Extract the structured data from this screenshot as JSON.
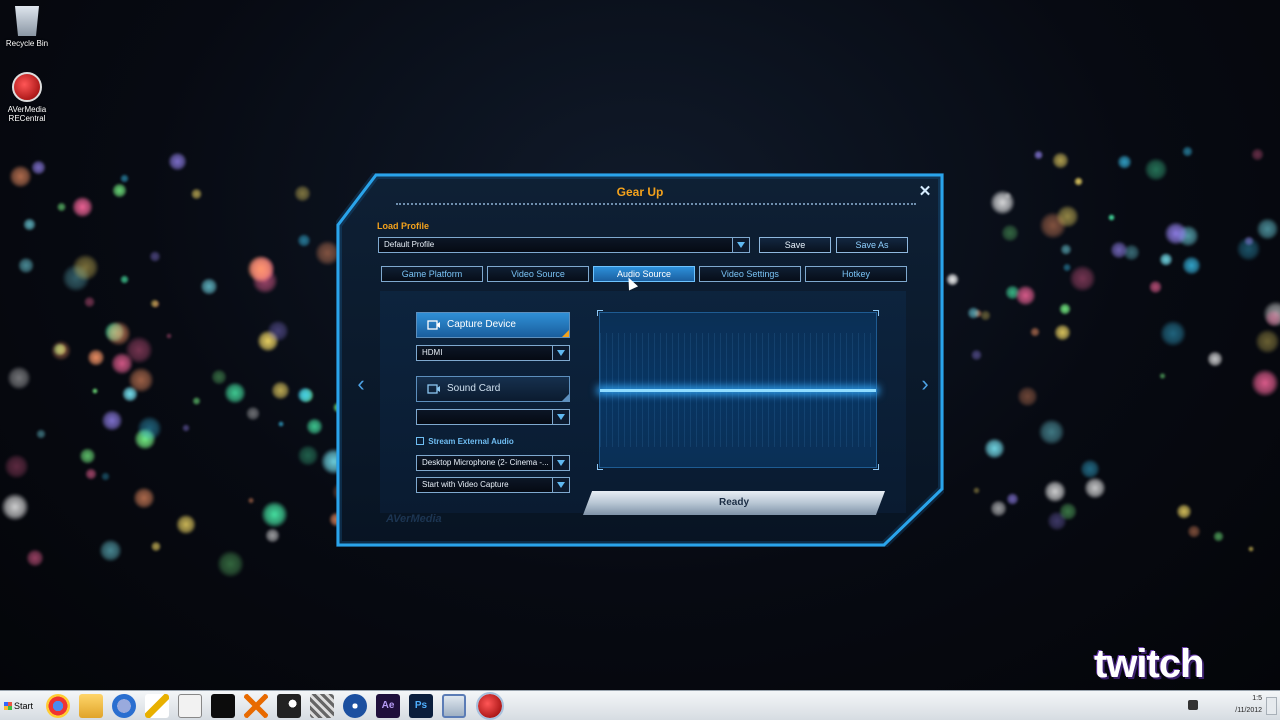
{
  "desktop": {
    "icons": [
      {
        "label": "Recycle Bin"
      },
      {
        "label": "AVerMedia RECentral"
      }
    ]
  },
  "dialog": {
    "title": "Gear Up",
    "close_glyph": "✕",
    "load_profile_label": "Load Profile",
    "profile_value": "Default Profile",
    "save_label": "Save",
    "save_as_label": "Save As",
    "tabs": [
      {
        "label": "Game Platform"
      },
      {
        "label": "Video Source"
      },
      {
        "label": "Audio Source"
      },
      {
        "label": "Video Settings"
      },
      {
        "label": "Hotkey"
      }
    ],
    "active_tab": "Audio Source",
    "capture_device_label": "Capture Device",
    "capture_device_value": "HDMI",
    "sound_card_label": "Sound Card",
    "sound_card_value": "",
    "stream_external_audio_label": "Stream External Audio",
    "stream_external_audio_checked": false,
    "external_audio_device_value": "Desktop Microphone (2- Cinema -...",
    "external_audio_mode_value": "Start with Video Capture",
    "ready_label": "Ready",
    "brand": "AVerMedia",
    "prev_arrow": "‹",
    "next_arrow": "›"
  },
  "watermark": {
    "text": "twitch"
  },
  "taskbar": {
    "start_label": "Start",
    "apps": [
      {
        "icon": "chrome-icon"
      },
      {
        "icon": "file-explorer-icon"
      },
      {
        "icon": "itunes-icon"
      },
      {
        "icon": "pencil-app-icon"
      },
      {
        "icon": "rabbit-app-icon"
      },
      {
        "icon": "media-player-icon"
      },
      {
        "icon": "x-app-icon"
      },
      {
        "icon": "steam-icon"
      },
      {
        "icon": "settings-app-icon"
      },
      {
        "icon": "disc-app-icon"
      },
      {
        "icon": "after-effects-icon",
        "text": "Ae"
      },
      {
        "icon": "photoshop-icon",
        "text": "Ps"
      },
      {
        "icon": "window-app-icon"
      },
      {
        "icon": "recentral-app-icon"
      }
    ],
    "clock_time": "1:5",
    "clock_date": "/11/2012"
  }
}
